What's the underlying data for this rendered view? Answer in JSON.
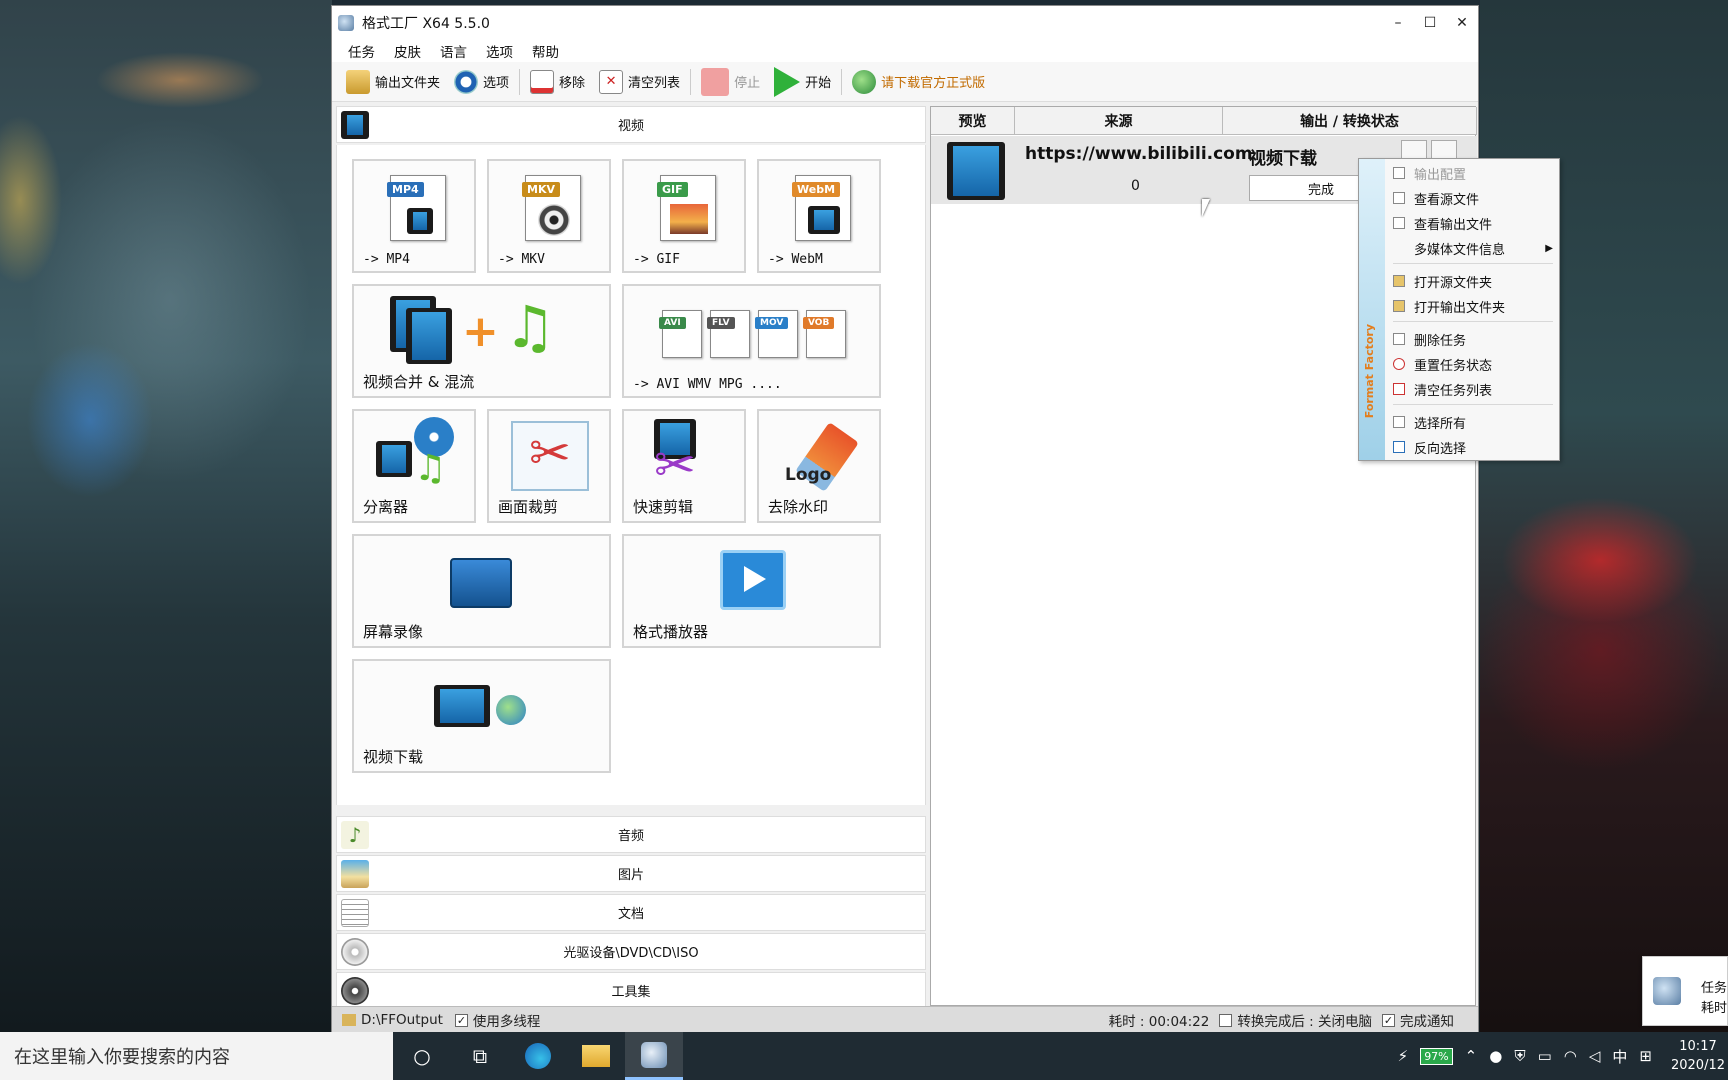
{
  "window": {
    "title": "格式工厂 X64 5.5.0",
    "controls": [
      "–",
      "☐",
      "✕"
    ]
  },
  "menu": [
    "任务",
    "皮肤",
    "语言",
    "选项",
    "帮助"
  ],
  "toolbar": {
    "output_folder": "输出文件夹",
    "options": "选项",
    "remove": "移除",
    "clear_list": "清空列表",
    "stop": "停止",
    "start": "开始",
    "download_official": "请下载官方正式版"
  },
  "categories": {
    "video": "视频",
    "audio": "音频",
    "picture": "图片",
    "document": "文档",
    "rom": "光驱设备\\DVD\\CD\\ISO",
    "tools": "工具集"
  },
  "tiles": {
    "mp4": {
      "tag": "MP4",
      "label": "-> MP4"
    },
    "mkv": {
      "tag": "MKV",
      "label": "-> MKV"
    },
    "gif": {
      "tag": "GIF",
      "label": "-> GIF"
    },
    "webm": {
      "tag": "WebM",
      "label": "-> WebM"
    },
    "merge": {
      "label": "视频合并 & 混流"
    },
    "multi": {
      "label": "-> AVI WMV MPG ....",
      "tags": [
        "AVI",
        "FLV",
        "MOV",
        "VOB"
      ]
    },
    "splitter": {
      "label": "分离器"
    },
    "crop": {
      "label": "画面裁剪"
    },
    "quickcut": {
      "label": "快速剪辑"
    },
    "delogo": {
      "label": "去除水印",
      "logo_text": "Logo"
    },
    "recorder": {
      "label": "屏幕录像"
    },
    "player": {
      "label": "格式播放器"
    },
    "downloader": {
      "label": "视频下载"
    }
  },
  "task_table": {
    "headers": [
      "预览",
      "来源",
      "输出 / 转换状态"
    ],
    "row": {
      "source": "https://www.bilibili.com",
      "count": "0",
      "state": "视频下载",
      "button": "完成"
    }
  },
  "context_menu": {
    "brand": "Format Factory",
    "items": [
      {
        "label": "输出配置",
        "disabled": true
      },
      {
        "label": "查看源文件"
      },
      {
        "label": "查看输出文件"
      },
      {
        "label": "多媒体文件信息",
        "submenu": true
      },
      {
        "label": "打开源文件夹"
      },
      {
        "label": "打开输出文件夹"
      },
      {
        "label": "删除任务"
      },
      {
        "label": "重置任务状态"
      },
      {
        "label": "清空任务列表"
      },
      {
        "label": "选择所有"
      },
      {
        "label": "反向选择"
      }
    ]
  },
  "statusbar": {
    "output_path": "D:\\FFOutput",
    "multithread": "使用多线程",
    "elapsed": "耗时 : 00:04:22",
    "after_done": "转换完成后 : 关闭电脑",
    "notify": "完成通知"
  },
  "taskbar": {
    "search_placeholder": "在这里输入你要搜索的内容",
    "battery": "97%",
    "ime": "中",
    "clock_time": "10:17",
    "clock_date": "2020/12"
  },
  "desktop": {
    "toast_line1": "任务",
    "toast_line2": "耗时"
  },
  "colors": {
    "accent_blue": "#1f7fc8",
    "tag_mp4": "#2a6fb8",
    "tag_mkv": "#c88c1a",
    "tag_gif": "#3a9b4a",
    "tag_webm": "#e08a2a",
    "start_green": "#2fb13a",
    "stop_red": "#f0a0a0"
  }
}
